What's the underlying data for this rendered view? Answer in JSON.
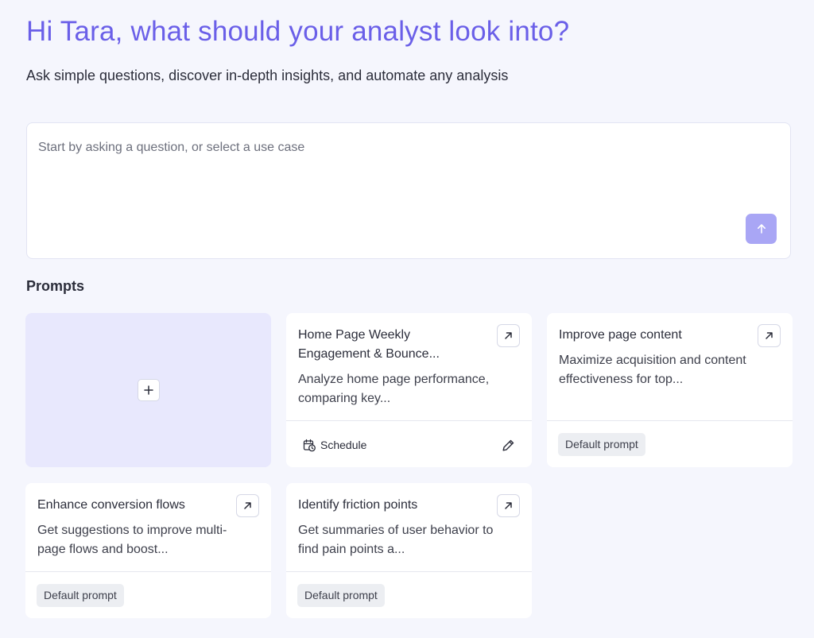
{
  "header": {
    "greeting": "Hi Tara, what should your analyst look into?",
    "subtitle": "Ask simple questions, discover in-depth insights, and automate any analysis"
  },
  "ask": {
    "placeholder": "Start by asking a question, or select a use case",
    "send_icon": "arrow-up-icon"
  },
  "prompts": {
    "section_title": "Prompts",
    "add_icon": "plus-icon",
    "open_icon": "arrow-up-right-icon",
    "cards": [
      {
        "title": "Home Page Weekly Engagement & Bounce...",
        "description": "Analyze home page performance, comparing key...",
        "footer_action": "Schedule",
        "footer_icon": "calendar-clock-icon",
        "edit_icon": "pencil-icon"
      },
      {
        "title": "Improve page content",
        "description": "Maximize acquisition and content effectiveness for top...",
        "badge": "Default prompt"
      },
      {
        "title": "Enhance conversion flows",
        "description": "Get suggestions to improve multi-page flows and boost...",
        "badge": "Default prompt"
      },
      {
        "title": "Identify friction points",
        "description": "Get summaries of user behavior to find pain points a...",
        "badge": "Default prompt"
      }
    ]
  },
  "colors": {
    "accent": "#6a5fe8",
    "send_button": "#a9a6f5",
    "add_card_bg": "#e8e8fd",
    "page_bg": "#f5f6fd"
  }
}
